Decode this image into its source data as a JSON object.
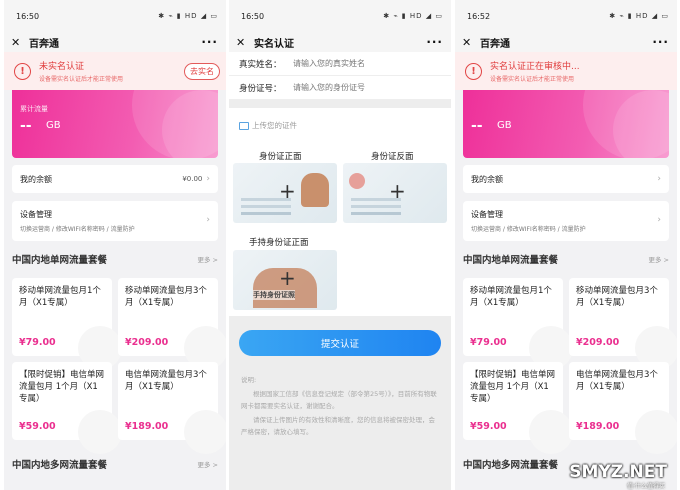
{
  "screen1": {
    "time": "16:50",
    "status_icons": "✱ ⌁ ▮ HD ◢ ▭",
    "title": "百奔通",
    "alert": {
      "title": "未实名认证",
      "subtitle": "设备需实名认证后才能正常使用",
      "button": "去实名"
    },
    "banner": {
      "label": "累计流量",
      "value": "--",
      "unit": "GB"
    },
    "balance": {
      "label": "我的余额",
      "value": "¥0.00"
    },
    "device": {
      "title": "设备管理",
      "subtitle": "切换运营商 / 修改WIFI名称密码 / 流量防护"
    },
    "section1": {
      "title": "中国内地单网流量套餐",
      "more": "更多 >"
    },
    "packages": [
      {
        "name": "移动单网流量包月1个月（X1专属）",
        "price": "¥79.00"
      },
      {
        "name": "移动单网流量包月3个月（X1专属）",
        "price": "¥209.00"
      },
      {
        "name": "【限时促销】电信单网流量包月 1个月（X1专属）",
        "price": "¥59.00"
      },
      {
        "name": "电信单网流量包月3个月（X1专属）",
        "price": "¥189.00"
      }
    ],
    "section2": {
      "title": "中国内地多网流量套餐",
      "more": "更多 >"
    }
  },
  "screen2": {
    "time": "16:50",
    "status_icons": "✱ ⌁ ▮ HD ◢ ▭",
    "title": "实名认证",
    "name_label": "真实姓名：",
    "name_placeholder": "请输入您的真实姓名",
    "id_label": "身份证号：",
    "id_placeholder": "请输入您的身份证号",
    "upload_hint": "上传您的证件",
    "front_label": "身份证正面",
    "back_label": "身份证反面",
    "hold_label": "手持身份证正面",
    "hold_caption": "手持身份证照",
    "submit": "提交认证",
    "notes_title": "说明:",
    "notes": [
      "根据国家工信部《信息登记规定（部令第25号）》，目前所有物联网卡都需要实名认证，谢谢配合。",
      "请保证上传图片的有效性和清晰度，您的信息将被保密处理，会严格保密，请放心填写。"
    ]
  },
  "screen3": {
    "time": "16:52",
    "status_icons": "✱ ⌁ ▮ HD ◢ ▭",
    "title": "百奔通",
    "alert": {
      "title": "实名认证正在审核中...",
      "subtitle": "设备需实名认证后才能正常使用"
    },
    "banner": {
      "value": "--",
      "unit": "GB"
    },
    "balance": {
      "label": "我的余额"
    },
    "device": {
      "title": "设备管理",
      "subtitle": "切换运营商 / 修改WIFI名称密码 / 流量防护"
    },
    "section1": {
      "title": "中国内地单网流量套餐",
      "more": "更多 >"
    },
    "packages": [
      {
        "name": "移动单网流量包月1个月（X1专属）",
        "price": "¥79.00"
      },
      {
        "name": "移动单网流量包月3个月（X1专属）",
        "price": "¥209.00"
      },
      {
        "name": "【限时促销】电信单网流量包月 1个月（X1专属）",
        "price": "¥59.00"
      },
      {
        "name": "电信单网流量包月3个月（X1专属）",
        "price": "¥189.00"
      }
    ],
    "section2": {
      "title": "中国内地多网流量套餐"
    },
    "watermark": "SMYZ.NET",
    "watermark_sub": "值·什么值得买"
  },
  "colors": {
    "accent_pink": "#ea2f8f",
    "alert_red": "#e03c3c",
    "submit_blue": "#1f84f1"
  }
}
